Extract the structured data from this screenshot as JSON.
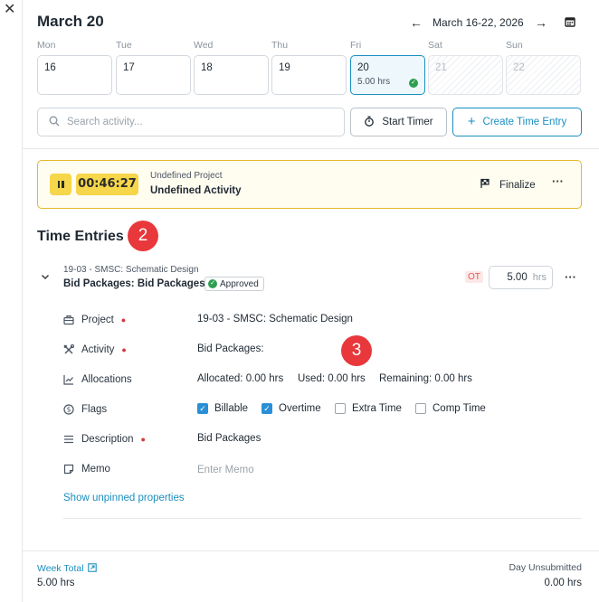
{
  "header": {
    "date_title": "March 20",
    "week_range": "March 16-22, 2026",
    "prev_icon": "arrow-left-icon",
    "next_icon": "arrow-right-icon",
    "calendar_icon": "calendar-icon"
  },
  "days": [
    {
      "label": "Mon",
      "num": "16",
      "hrs": ""
    },
    {
      "label": "Tue",
      "num": "17",
      "hrs": ""
    },
    {
      "label": "Wed",
      "num": "18",
      "hrs": ""
    },
    {
      "label": "Thu",
      "num": "19",
      "hrs": ""
    },
    {
      "label": "Fri",
      "num": "20",
      "hrs": "5.00 hrs"
    },
    {
      "label": "Sat",
      "num": "21",
      "hrs": ""
    },
    {
      "label": "Sun",
      "num": "22",
      "hrs": ""
    }
  ],
  "toolbar": {
    "search_placeholder": "Search activity...",
    "start_timer": "Start Timer",
    "create_entry": "Create Time Entry"
  },
  "timer": {
    "elapsed": "00:46:27",
    "project": "Undefined Project",
    "activity": "Undefined Activity",
    "finalize": "Finalize"
  },
  "section": {
    "title": "Time Entries",
    "badge_2": "2",
    "badge_3": "3"
  },
  "entry": {
    "project": "19-03 - SMSC: Schematic Design",
    "activity": "Bid Packages: Bid Packages",
    "status": "Approved",
    "ot": "OT",
    "hours": "5.00",
    "hours_unit": "hrs"
  },
  "props": {
    "project_label": "Project",
    "project_value": "19-03 - SMSC: Schematic Design",
    "activity_label": "Activity",
    "activity_value": "Bid Packages:",
    "allocations_label": "Allocations",
    "allocated": "Allocated: 0.00 hrs",
    "used": "Used: 0.00 hrs",
    "remaining": "Remaining: 0.00 hrs",
    "flags_label": "Flags",
    "flag_billable": "Billable",
    "flag_overtime": "Overtime",
    "flag_extra": "Extra Time",
    "flag_comp": "Comp Time",
    "description_label": "Description",
    "description_value": "Bid Packages",
    "memo_label": "Memo",
    "memo_placeholder": "Enter Memo",
    "show_unpinned": "Show unpinned properties"
  },
  "footer": {
    "week_total_label": "Week Total",
    "week_total_value": "5.00 hrs",
    "day_unsubmitted_label": "Day Unsubmitted",
    "day_unsubmitted_value": "0.00 hrs"
  },
  "colors": {
    "accent": "#1a8fbf",
    "timer_yellow": "#f6d64a",
    "annotation_red": "#e8383b",
    "approved_green": "#2e9e4f"
  }
}
